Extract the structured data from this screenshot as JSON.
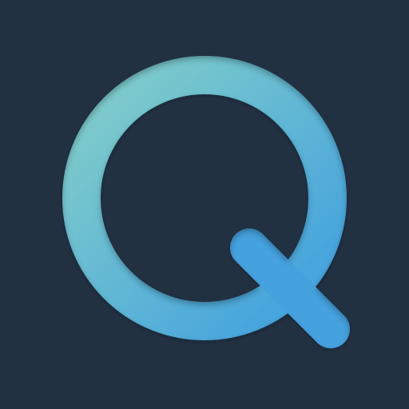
{
  "app_icon": {
    "glyph": "Q",
    "icon": "q-letter-logo-icon",
    "colors": {
      "background": "#223142",
      "gradient_start": "#84CFC9",
      "gradient_end": "#3F9FE0",
      "inner_shadow": "#0F1A26"
    }
  }
}
